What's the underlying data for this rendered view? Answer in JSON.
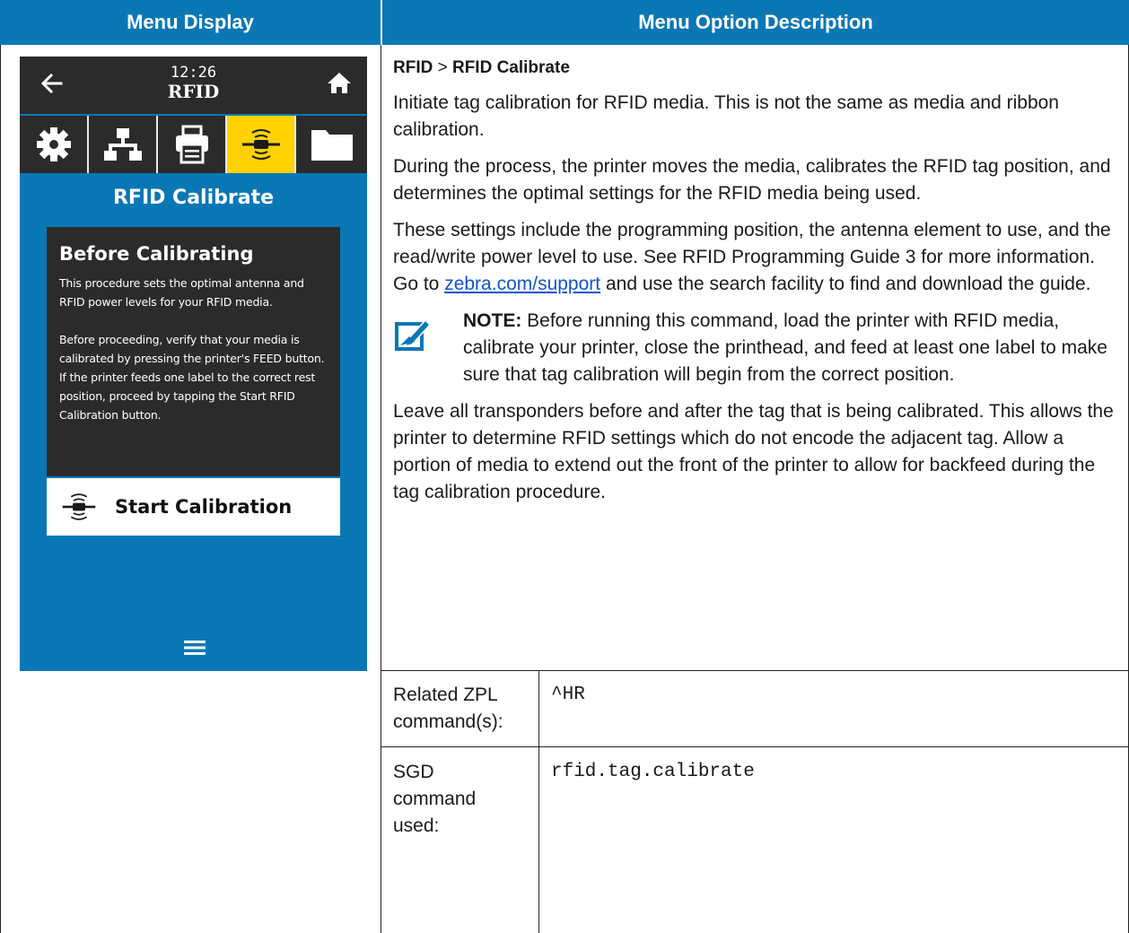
{
  "table": {
    "header_left": "Menu Display",
    "header_right": "Menu Option Description"
  },
  "display": {
    "time": "12:26",
    "mode": "RFID",
    "icons": [
      "gear-icon",
      "network-icon",
      "printer-icon",
      "rfid-icon",
      "folder-icon"
    ],
    "active_icon_index": 3,
    "screen_title": "RFID Calibrate",
    "panel_title": "Before Calibrating",
    "panel_para1": "This procedure sets the optimal antenna and RFID power levels for your RFID media.",
    "panel_para2": "Before proceeding, verify that your media is calibrated by pressing the printer's FEED button. If the printer feeds one label to the correct rest position, proceed by tapping the Start RFID Calibration button.",
    "button_label": "Start Calibration",
    "colors": {
      "screen_bg": "#0a77b5",
      "bar_bg": "#2b2b2b",
      "active_tab": "#ffd200"
    }
  },
  "description": {
    "crumb_part1": "RFID",
    "crumb_sep": " > ",
    "crumb_part2": "RFID Calibrate",
    "para1": "Initiate tag calibration for RFID media. This is not the same as media and ribbon calibration.",
    "para2": "During the process, the printer moves the media, calibrates the RFID tag position, and determines the optimal settings for the RFID media being used.",
    "para3_before": "These settings include the programming position, the antenna element to use, and the read/write power level to use. See RFID Programming Guide 3 for more information. Go to ",
    "para3_link": "zebra.com/support",
    "para3_after": " and use the search facility to find and download the guide.",
    "note_label": "NOTE:",
    "note_text": " Before running this command, load the printer with RFID media, calibrate your printer, close the printhead, and feed at least one label to make sure that tag calibration will begin from the correct position.",
    "para4": "Leave all transponders before and after the tag that is being calibrated. This allows the printer to determine RFID settings which do not encode the adjacent tag. Allow a portion of media to extend out the front of the printer to allow for backfeed during the tag calibration procedure."
  },
  "commands": {
    "zpl_label_line1": "Related ZPL",
    "zpl_label_line2": "command(s):",
    "zpl_value": "^HR",
    "sgd_label_line1": "SGD",
    "sgd_label_line2": "command",
    "sgd_label_line3": "used:",
    "sgd_value": "rfid.tag.calibrate"
  }
}
